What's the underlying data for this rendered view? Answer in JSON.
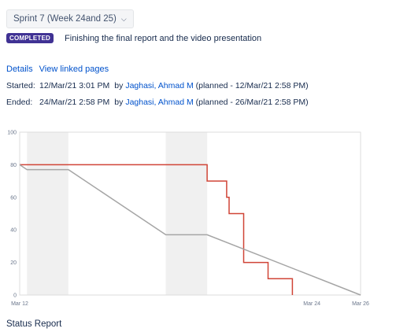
{
  "sprint": {
    "name": "Sprint 7 (Week 24and 25)"
  },
  "status": {
    "badge": "COMPLETED",
    "goal": "Finishing the final report and the video presentation"
  },
  "details": {
    "label": "Details",
    "link": "View linked pages"
  },
  "started": {
    "label": "Started:",
    "date": "12/Mar/21 3:01 PM",
    "by": "by",
    "user": "Jaghasi, Ahmad M",
    "planned": "(planned - 12/Mar/21 2:58 PM)"
  },
  "ended": {
    "label": "Ended:",
    "date": "24/Mar/21 2:58 PM",
    "by": "by",
    "user": "Jaghasi, Ahmad M",
    "planned": "(planned - 26/Mar/21 2:58 PM)"
  },
  "status_report": {
    "title": "Status Report"
  },
  "chart_data": {
    "type": "line",
    "xlabel": "",
    "ylabel": "",
    "x_ticks": [
      "Mar 12",
      "Mar 24",
      "Mar 26"
    ],
    "y_ticks": [
      0,
      20,
      40,
      60,
      80,
      100
    ],
    "ylim": [
      0,
      100
    ],
    "grid": false,
    "non_working_bands": [
      [
        "Mar 12.3",
        "Mar 14"
      ],
      [
        "Mar 18",
        "Mar 19.7"
      ]
    ],
    "series": [
      {
        "color": "#d04437",
        "style": "step",
        "points": [
          [
            "Mar 12",
            80
          ],
          [
            "Mar 19.7",
            80
          ],
          [
            "Mar 19.7",
            70
          ],
          [
            "Mar 20.5",
            70
          ],
          [
            "Mar 20.5",
            60
          ],
          [
            "Mar 20.6",
            60
          ],
          [
            "Mar 20.6",
            50
          ],
          [
            "Mar 21.2",
            50
          ],
          [
            "Mar 21.2",
            20
          ],
          [
            "Mar 22.2",
            20
          ],
          [
            "Mar 22.2",
            10
          ],
          [
            "Mar 23.2",
            10
          ],
          [
            "Mar 23.2",
            0
          ]
        ]
      },
      {
        "color": "#a5a5a5",
        "style": "guideline",
        "points": [
          [
            "Mar 12",
            80
          ],
          [
            "Mar 12.3",
            77
          ],
          [
            "Mar 14",
            77
          ],
          [
            "Mar 18",
            37
          ],
          [
            "Mar 19.7",
            37
          ],
          [
            "Mar 26",
            0
          ]
        ]
      }
    ]
  }
}
